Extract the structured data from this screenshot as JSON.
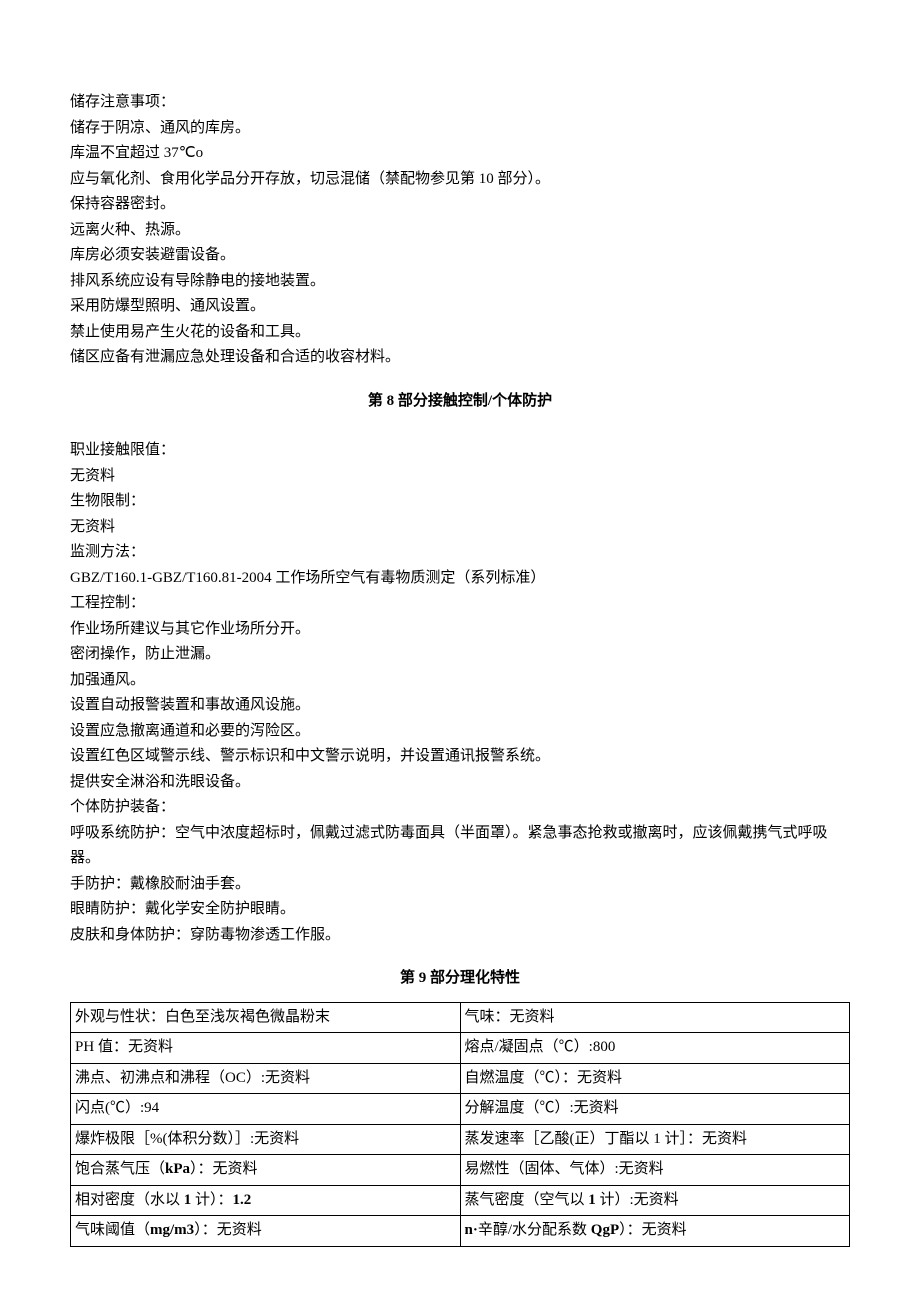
{
  "storage": {
    "heading": "储存注意事项：",
    "l1": "储存于阴凉、通风的库房。",
    "l2a": "库温不宜超过 ",
    "l2b": "37℃o",
    "l3a": "应与氧化剂、食用化学品分开存放，切忌混储（禁配物参见第 ",
    "l3b": "10",
    "l3c": " 部分）。",
    "l4": "保持容器密封。",
    "l5": "远离火种、热源。",
    "l6": "库房必须安装避雷设备。",
    "l7": "排风系统应设有导除静电的接地装置。",
    "l8": "采用防爆型照明、通风设置。",
    "l9": "禁止使用易产生火花的设备和工具。",
    "l10": "储区应备有泄漏应急处理设备和合适的收容材料。"
  },
  "section8": {
    "title_pre": "第 ",
    "title_num": "8",
    "title_post": " 部分接触控制/个体防护",
    "l1": "职业接触限值：",
    "l2": "无资料",
    "l3": "生物限制：",
    "l4": "无资料",
    "l5": "监测方法：",
    "l6a": "GBZ/T160.1-GBZ/T160.81-2004",
    "l6b": " 工作场所空气有毒物质测定（系列标准）",
    "l7": "工程控制：",
    "l8": "作业场所建议与其它作业场所分开。",
    "l9": "密闭操作，防止泄漏。",
    "l10": "加强通风。",
    "l11": "设置自动报警装置和事故通风设施。",
    "l12": "设置应急撤离通道和必要的泻险区。",
    "l13": "设置红色区域警示线、警示标识和中文警示说明，并设置通讯报警系统。",
    "l14": "提供安全淋浴和洗眼设备。",
    "l15": "个体防护装备：",
    "l16": "呼吸系统防护：空气中浓度超标时，佩戴过滤式防毒面具（半面罩）。紧急事态抢救或撤离时，应该佩戴携气式呼吸器。",
    "l17": "手防护：戴橡胶耐油手套。",
    "l18": "眼睛防护：戴化学安全防护眼睛。",
    "l19": "皮肤和身体防护：穿防毒物渗透工作服。"
  },
  "section9": {
    "title_pre": "第 ",
    "title_num": "9",
    "title_post": " 部分理化特性",
    "r1c1": "外观与性状：白色至浅灰褐色微晶粉末",
    "r1c2": "气味：无资料",
    "r2c1a": "PH",
    "r2c1b": " 值：无资料",
    "r2c2a": "熔点/凝固点（℃）",
    "r2c2b": ":800",
    "r3c1a": "沸点、初沸点和沸程（",
    "r3c1b": "OC",
    "r3c1c": "）:无资料",
    "r3c2": "自燃温度（℃）：无资料",
    "r4c1a": "闪点(℃）",
    "r4c1b": ":94",
    "r4c2": "分解温度（℃）:无资料",
    "r5c1a": "爆炸极限［",
    "r5c1b": "%",
    "r5c1c": "(体积分数）］:无资料",
    "r5c2a": "蒸发速率［乙酸(正）丁酯以 ",
    "r5c2b": "1",
    "r5c2c": " 计］：无资料",
    "r6c1a": "饱合蒸气压（",
    "r6c1b": "kPa",
    "r6c1c": "）：无资料",
    "r6c2": "易燃性（固体、气体）:无资料",
    "r7c1a": "相对密度（水以 ",
    "r7c1b": "1",
    "r7c1c": " 计）：",
    "r7c1d": "1.2",
    "r7c2a": "蒸气密度（空气以 ",
    "r7c2b": "1",
    "r7c2c": " 计）:无资料",
    "r8c1a": "气味阈值（",
    "r8c1b": "mg/m3",
    "r8c1c": "）：无资料",
    "r8c2a": "n·",
    "r8c2b": "辛醇/水分配系数 ",
    "r8c2c": "QgP",
    "r8c2d": "）：无资料"
  }
}
